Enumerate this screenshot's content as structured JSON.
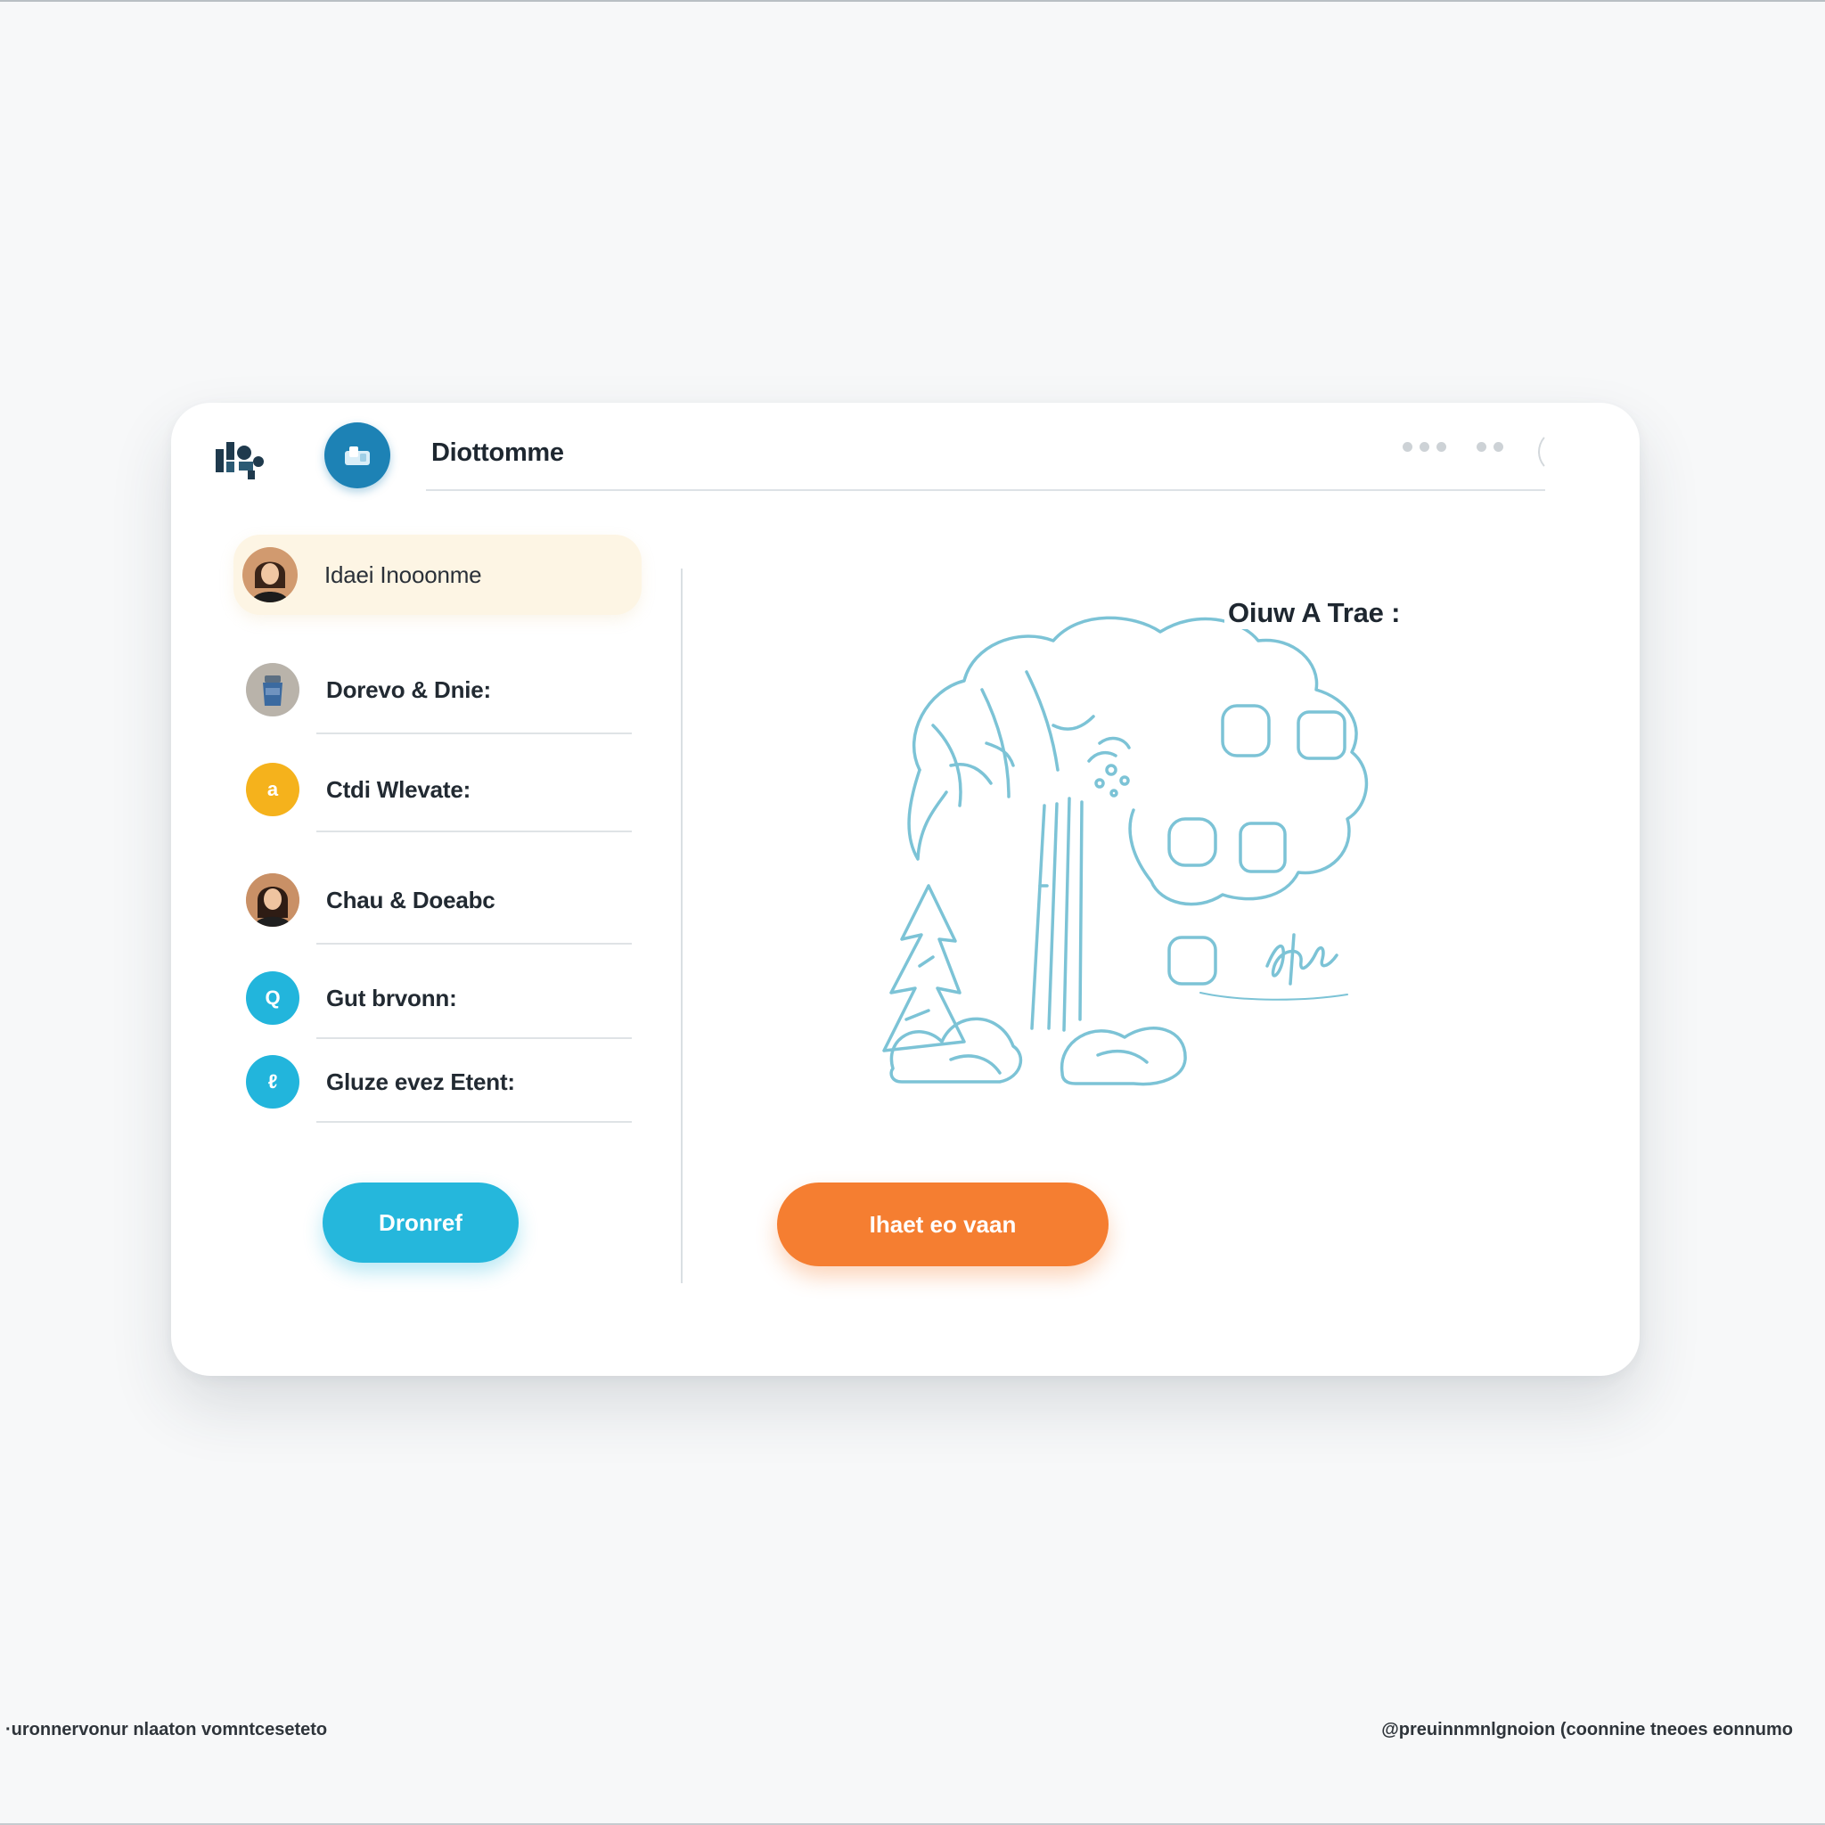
{
  "header": {
    "app_title": "Diottomme",
    "brand_logo_icon": "brand-logo-icon",
    "app_icon": "app-icon",
    "window_control_icon": "window-dots-icon"
  },
  "sidebar": {
    "items": [
      {
        "label": "Idaei Inooonme",
        "avatar": "person-avatar",
        "active": true
      },
      {
        "label": "Dorevo & Dnie:",
        "avatar": "bottle-avatar",
        "active": false
      },
      {
        "label": "Ctdi Wlevate:",
        "avatar": "badge",
        "badge_letter": "a",
        "badge_color": "#f5b21c",
        "active": false
      },
      {
        "label": "Chau & Doeabc",
        "avatar": "person-avatar",
        "active": false
      },
      {
        "label": "Gut brvonn:",
        "avatar": "badge",
        "badge_letter": "Q",
        "badge_color": "#22b5dc",
        "active": false
      },
      {
        "label": "Gluze evez Etent:",
        "avatar": "badge",
        "badge_letter": "ℓ",
        "badge_color": "#22b5dc",
        "active": false
      }
    ],
    "primary_button_label": "Dronref"
  },
  "main": {
    "drawing_title": "Oiuw A Trae :",
    "drawing_signature": "sfhal",
    "secondary_button_label": "Ihaet eo vaan"
  },
  "footer": {
    "left_text": "·uronnervonur nlaaton vomntceseteto",
    "right_text": "@preuinnmnlgnoion  (coonnine tneoes eonnumo"
  },
  "colors": {
    "accent_blue": "#25b7dc",
    "accent_orange": "#f57e31",
    "app_icon_blue": "#1d82b5",
    "active_row": "#fdf5e4",
    "sketch_line": "#7cc3d6"
  }
}
